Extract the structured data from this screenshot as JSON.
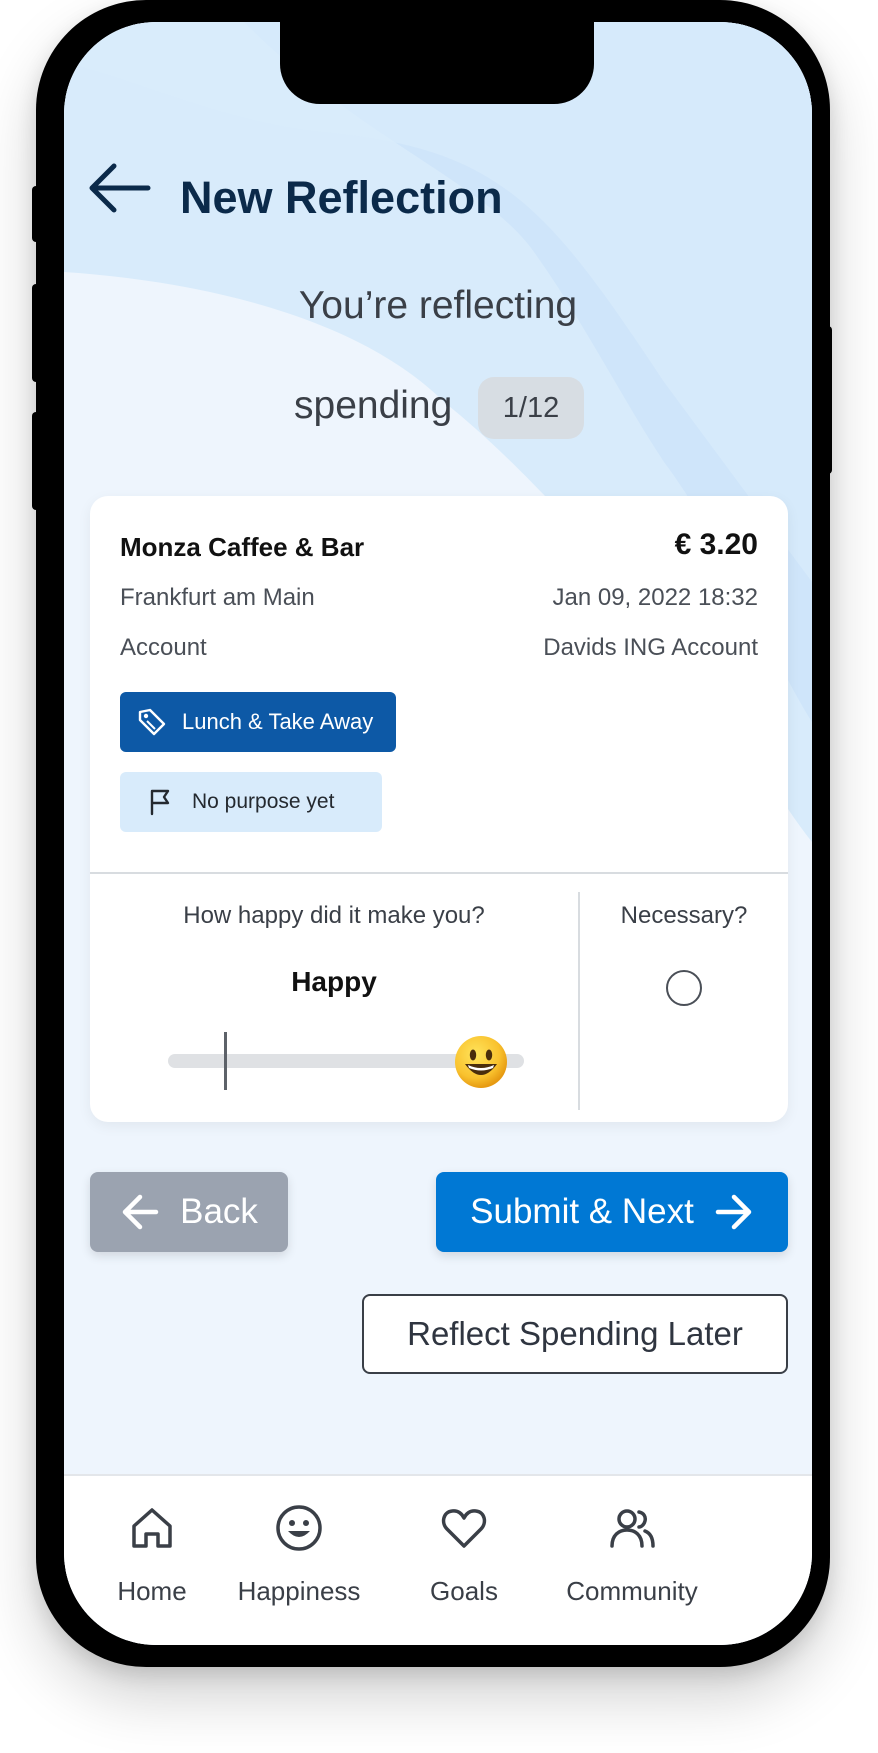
{
  "header": {
    "title": "New Reflection",
    "subtitle_line1": "You’re reflecting",
    "subtitle_line2": "spending",
    "counter": "1/12"
  },
  "transaction": {
    "merchant": "Monza Caffee & Bar",
    "amount": "€ 3.20",
    "location": "Frankfurt am Main",
    "datetime": "Jan 09, 2022 18:32",
    "account_label": "Account",
    "account_value": "Davids ING Account",
    "category": "Lunch & Take Away",
    "purpose": "No purpose yet"
  },
  "reflection": {
    "happiness_question": "How happy did it make you?",
    "happiness_value": "Happy",
    "happiness_level": 0.88,
    "necessary_question": "Necessary?",
    "necessary_checked": false
  },
  "actions": {
    "back_label": "Back",
    "next_label": "Submit & Next",
    "later_label": "Reflect Spending Later"
  },
  "tabbar": {
    "items": [
      {
        "label": "Home",
        "icon": "home-icon"
      },
      {
        "label": "Happiness",
        "icon": "smiley-icon"
      },
      {
        "label": "Goals",
        "icon": "heart-icon"
      },
      {
        "label": "Community",
        "icon": "people-icon"
      }
    ]
  },
  "colors": {
    "primary": "#0078d4",
    "category_chip": "#0d59a6",
    "purpose_chip": "#d8ebfb",
    "back_button": "#9ba3b0",
    "title": "#0b2a4a"
  }
}
